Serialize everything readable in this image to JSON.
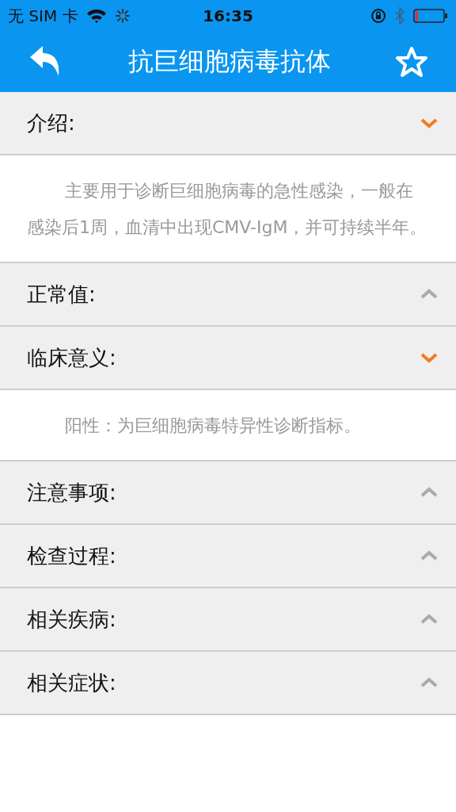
{
  "status_bar": {
    "carrier": "无 SIM 卡",
    "time": "16:35"
  },
  "nav_bar": {
    "title": "抗巨细胞病毒抗体"
  },
  "sections": [
    {
      "label": "介绍:",
      "expanded": true,
      "body": "主要用于诊断巨细胞病毒的急性感染，一般在感染后1周，血清中出现CMV-IgM，并可持续半年。"
    },
    {
      "label": "正常值:",
      "expanded": false
    },
    {
      "label": "临床意义:",
      "expanded": true,
      "body": "阳性：为巨细胞病毒特异性诊断指标。"
    },
    {
      "label": "注意事项:",
      "expanded": false
    },
    {
      "label": "检查过程:",
      "expanded": false
    },
    {
      "label": "相关疾病:",
      "expanded": false
    },
    {
      "label": "相关症状:",
      "expanded": false
    }
  ]
}
